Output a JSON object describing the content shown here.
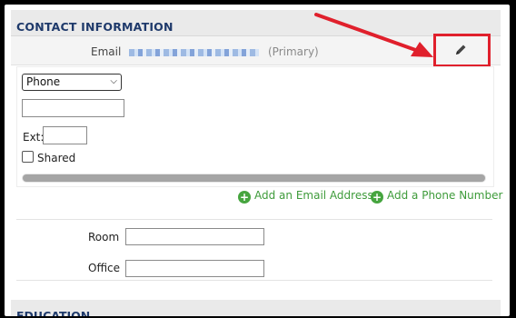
{
  "contact": {
    "section_title": "CONTACT INFORMATION",
    "email": {
      "label": "Email",
      "primary_note": "(Primary)",
      "edit_icon": "pencil-icon"
    },
    "phone": {
      "type_selected": "Phone",
      "number_value": "",
      "ext_label": "Ext:",
      "ext_value": "",
      "shared_label": "Shared",
      "shared_checked": false
    },
    "actions": {
      "add_email": "Add an Email Address",
      "add_phone": "Add a Phone Number"
    },
    "room_label": "Room",
    "room_value": "",
    "office_label": "Office",
    "office_value": ""
  },
  "education": {
    "section_title": "EDUCATION"
  },
  "annotation": {
    "highlight_color": "#e0202c"
  }
}
